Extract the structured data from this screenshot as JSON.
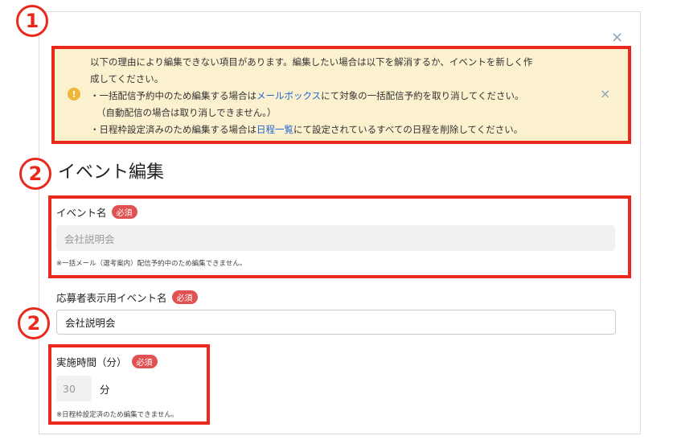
{
  "markers": {
    "one": "1",
    "two": "2"
  },
  "close_icon": "×",
  "alert": {
    "icon": "!",
    "line1": "以下の理由により編集できない項目があります。編集したい場合は以下を解消するか、イベントを新しく作",
    "line2": "成してください。",
    "line3_pre": "・一括配信予約中のため編集する場合は",
    "line3_link": "メールボックス",
    "line3_post": "にて対象の一括配信予約を取り消してください。",
    "line4": "（自動配信の場合は取り消しできません。）",
    "line5_pre": "・日程枠設定済みのため編集する場合は",
    "line5_link": "日程一覧",
    "line5_post": "にて設定されているすべての日程を削除してください。"
  },
  "section_title": "イベント編集",
  "fields": {
    "event_name": {
      "label": "イベント名",
      "required": "必須",
      "value": "会社説明会",
      "note": "※一括メール（選考案内）配信予約中のため編集できません。"
    },
    "display_name": {
      "label": "応募者表示用イベント名",
      "required": "必須",
      "value": "会社説明会"
    },
    "duration": {
      "label": "実施時間（分）",
      "required": "必須",
      "value": "30",
      "unit": "分",
      "note": "※日程枠設定済のため編集できません。"
    }
  }
}
